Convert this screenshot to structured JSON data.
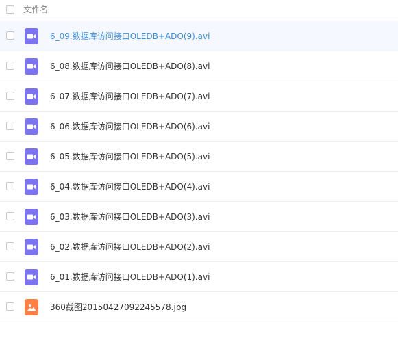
{
  "header": {
    "name_column": "文件名"
  },
  "files": [
    {
      "name": "6_09.数据库访问接口OLEDB+ADO(9).avi",
      "type": "video",
      "selected": true
    },
    {
      "name": "6_08.数据库访问接口OLEDB+ADO(8).avi",
      "type": "video",
      "selected": false
    },
    {
      "name": "6_07.数据库访问接口OLEDB+ADO(7).avi",
      "type": "video",
      "selected": false
    },
    {
      "name": "6_06.数据库访问接口OLEDB+ADO(6).avi",
      "type": "video",
      "selected": false
    },
    {
      "name": "6_05.数据库访问接口OLEDB+ADO(5).avi",
      "type": "video",
      "selected": false
    },
    {
      "name": "6_04.数据库访问接口OLEDB+ADO(4).avi",
      "type": "video",
      "selected": false
    },
    {
      "name": "6_03.数据库访问接口OLEDB+ADO(3).avi",
      "type": "video",
      "selected": false
    },
    {
      "name": "6_02.数据库访问接口OLEDB+ADO(2).avi",
      "type": "video",
      "selected": false
    },
    {
      "name": "6_01.数据库访问接口OLEDB+ADO(1).avi",
      "type": "video",
      "selected": false
    },
    {
      "name": "360截图20150427092245578.jpg",
      "type": "image",
      "selected": false
    }
  ],
  "colors": {
    "video_icon": "#7b73f0",
    "image_icon": "#ff7f45",
    "selected_text": "#3a8ee6"
  },
  "icons": {
    "video": "video-file-icon",
    "image": "image-file-icon"
  }
}
